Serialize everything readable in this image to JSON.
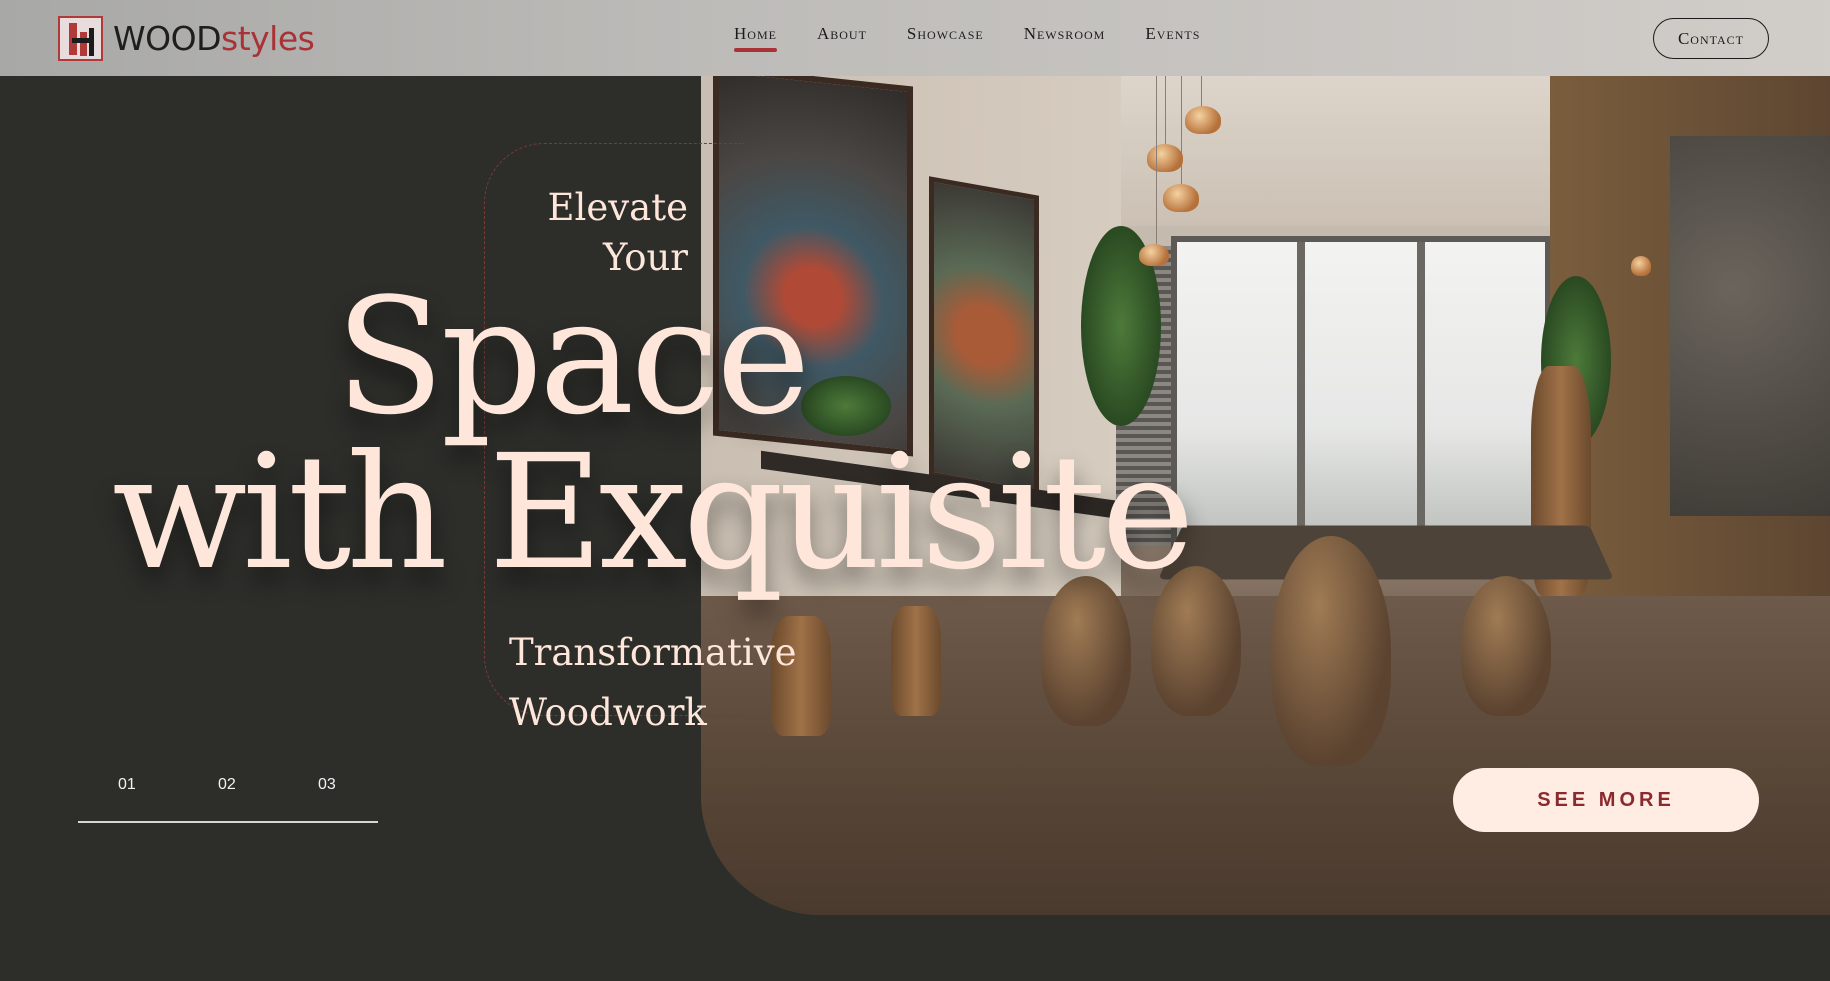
{
  "brand": {
    "wood": "WOOD",
    "styles": "styles",
    "accent_color": "#a83236"
  },
  "nav": {
    "items": [
      {
        "label": "Home",
        "active": true
      },
      {
        "label": "About",
        "active": false
      },
      {
        "label": "Showcase",
        "active": false
      },
      {
        "label": "Newsroom",
        "active": false
      },
      {
        "label": "Events",
        "active": false
      }
    ],
    "contact_label": "Contact"
  },
  "hero": {
    "line1": "Elevate",
    "line2": "Your",
    "line3": "Space",
    "line4": "with Exquisite",
    "line5": "Transformative",
    "line6": "Woodwork",
    "headline_color": "#ffe6da",
    "background_color": "#2d2e2a"
  },
  "pager": {
    "slides": [
      "01",
      "02",
      "03"
    ]
  },
  "cta": {
    "label": "SEE MORE"
  },
  "icons": {
    "logo": "woodstyles-logo-mark"
  }
}
